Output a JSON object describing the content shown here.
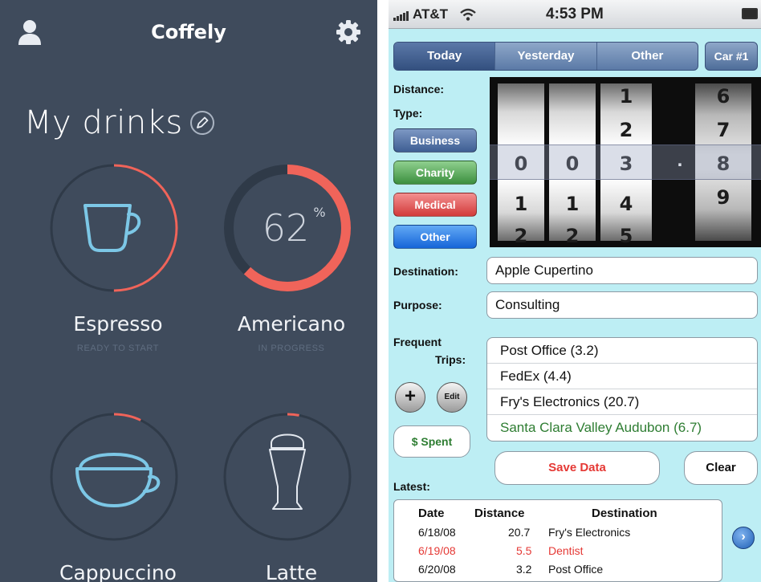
{
  "coffely": {
    "title": "Coffely",
    "page_title": "My drinks",
    "icons": {
      "user": "user-icon",
      "settings": "gear-icon",
      "edit": "pencil-icon"
    },
    "colors": {
      "background": "#3f4b5c",
      "accent": "#f0645a",
      "ring": "#2f3a48",
      "cup": "#7cc7e6"
    },
    "drinks": [
      {
        "name": "Espresso",
        "status": "READY TO START",
        "progress": 0.5
      },
      {
        "name": "Americano",
        "status": "IN PROGRESS",
        "progress": 0.62,
        "percent_value": "62",
        "percent_sign": "%"
      },
      {
        "name": "Cappuccino",
        "status": "",
        "progress": 0.07
      },
      {
        "name": "Latte",
        "status": "",
        "progress": 0.03
      }
    ]
  },
  "mileage": {
    "status_bar": {
      "carrier": "AT&T",
      "time": "4:53 PM"
    },
    "tabs": [
      {
        "label": "Today",
        "active": true
      },
      {
        "label": "Yesterday",
        "active": false
      },
      {
        "label": "Other",
        "active": false
      }
    ],
    "car_button": "Car #1",
    "labels": {
      "distance": "Distance:",
      "type": "Type:",
      "destination": "Destination:",
      "purpose": "Purpose:",
      "frequent": "Frequent",
      "trips": "Trips:",
      "latest": "Latest:"
    },
    "types": [
      {
        "label": "Business",
        "color": "#4f6ea3"
      },
      {
        "label": "Charity",
        "color": "#4ea050"
      },
      {
        "label": "Medical",
        "color": "#e04b4b"
      },
      {
        "label": "Other",
        "color": "#1e7be6"
      }
    ],
    "picker": {
      "wheels": [
        [
          "",
          "0",
          "1",
          "2"
        ],
        [
          "",
          "0",
          "1",
          "2"
        ],
        [
          "1",
          "2",
          "3",
          "4",
          "5"
        ],
        [
          "6",
          "7",
          "8",
          "9"
        ]
      ],
      "decimal": "."
    },
    "destination_value": "Apple Cupertino",
    "purpose_value": "Consulting",
    "frequent_trips": [
      "Post Office (3.2)",
      "FedEx (4.4)",
      "Fry's Electronics (20.7)",
      "Santa Clara Valley Audubon (6.7)"
    ],
    "add_label": "+",
    "edit_label": "Edit",
    "spent_label": "$ Spent",
    "save_label": "Save Data",
    "clear_label": "Clear",
    "latest_table": {
      "headers": [
        "Date",
        "Distance",
        "Destination"
      ],
      "rows": [
        {
          "date": "6/18/08",
          "distance": "20.7",
          "destination": "Fry's Electronics",
          "highlight": false
        },
        {
          "date": "6/19/08",
          "distance": "5.5",
          "destination": "Dentist",
          "highlight": true
        },
        {
          "date": "6/20/08",
          "distance": "3.2",
          "destination": "Post Office",
          "highlight": false
        }
      ]
    },
    "next_label": "›"
  }
}
